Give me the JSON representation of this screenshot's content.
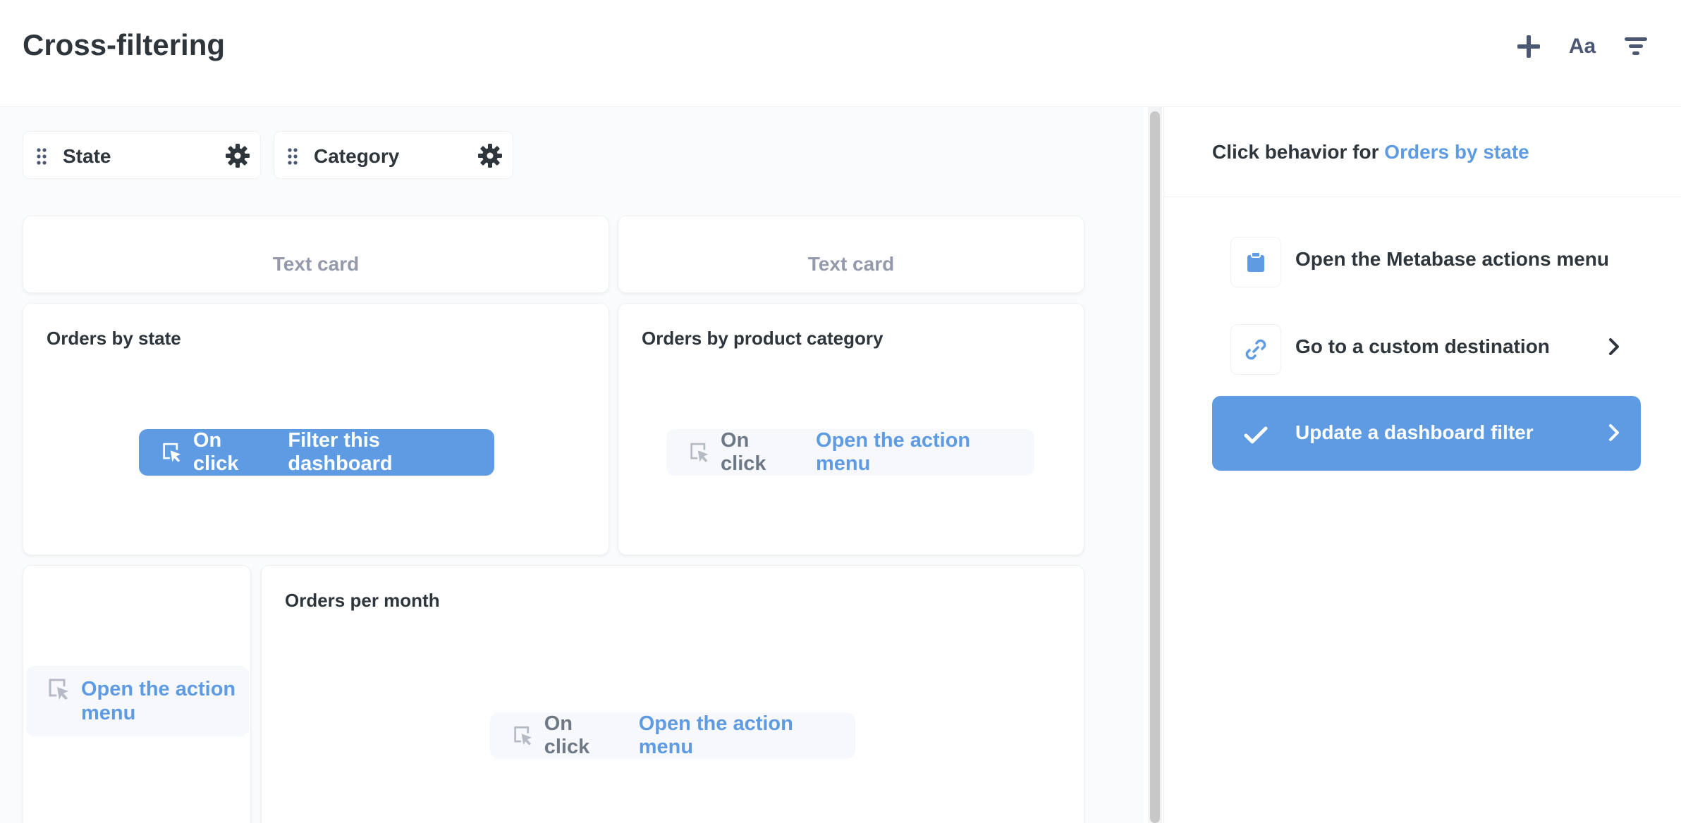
{
  "header": {
    "title": "Cross-filtering",
    "text_icon": "Aa",
    "icons": [
      "plus-icon",
      "text-card-icon",
      "filter-icon"
    ]
  },
  "filters": [
    {
      "label": "State"
    },
    {
      "label": "Category"
    }
  ],
  "cards": {
    "text_card_1": "Text card",
    "text_card_2": "Text card",
    "orders_by_state": {
      "title": "Orders by state",
      "on_click": "On click",
      "action": "Filter this dashboard"
    },
    "orders_by_category": {
      "title": "Orders by product category",
      "on_click": "On click",
      "action": "Open the action menu"
    },
    "small_card": {
      "action": "Open the action menu"
    },
    "orders_per_month": {
      "title": "Orders per month",
      "on_click": "On click",
      "action": "Open the action menu"
    }
  },
  "sidebar": {
    "title_prefix": "Click behavior for",
    "title_highlight": "Orders by state",
    "options": [
      {
        "label": "Open the Metabase actions menu",
        "icon": "clipboard-icon"
      },
      {
        "label": "Go to a custom destination",
        "icon": "link-icon"
      },
      {
        "label": "Update a dashboard filter",
        "icon": "check-icon",
        "selected": true
      }
    ]
  },
  "colors": {
    "brand": "#5e9be3",
    "text_dark": "#2e353b",
    "text_light": "#949aab",
    "canvas_bg": "#f9fbfc"
  }
}
